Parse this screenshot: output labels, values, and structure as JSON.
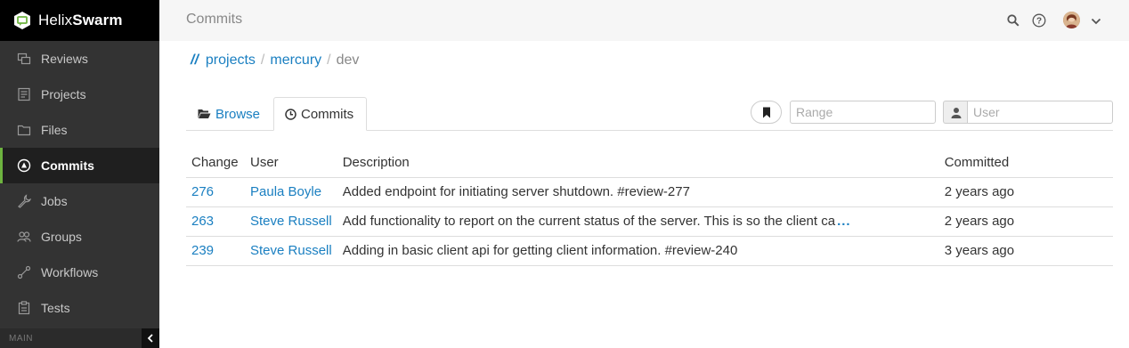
{
  "brand": {
    "name_light": "Helix",
    "name_bold": "Swarm"
  },
  "sidebar": {
    "items": [
      {
        "label": "Reviews",
        "icon": "reviews-icon"
      },
      {
        "label": "Projects",
        "icon": "projects-icon"
      },
      {
        "label": "Files",
        "icon": "folder-icon"
      },
      {
        "label": "Commits",
        "icon": "commit-icon",
        "active": true
      },
      {
        "label": "Jobs",
        "icon": "wrench-icon"
      },
      {
        "label": "Groups",
        "icon": "group-icon"
      },
      {
        "label": "Workflows",
        "icon": "workflow-icon"
      },
      {
        "label": "Tests",
        "icon": "clipboard-icon"
      }
    ],
    "footer_label": "MAIN"
  },
  "header": {
    "title": "Commits"
  },
  "breadcrumb": {
    "root": "//",
    "items": [
      "projects",
      "mercury"
    ],
    "current": "dev"
  },
  "tabs": {
    "browse": "Browse",
    "commits": "Commits"
  },
  "filters": {
    "range_placeholder": "Range",
    "user_placeholder": "User"
  },
  "table": {
    "headers": {
      "change": "Change",
      "user": "User",
      "description": "Description",
      "committed": "Committed"
    },
    "rows": [
      {
        "change": "276",
        "user": "Paula Boyle",
        "description": "Added endpoint for initiating server shutdown. #review-277",
        "truncated": false,
        "committed": "2 years ago"
      },
      {
        "change": "263",
        "user": "Steve Russell",
        "description": "Add functionality to report on the current status of the server. This is so the client ca",
        "truncated": true,
        "ellipsis": "...",
        "committed": "2 years ago"
      },
      {
        "change": "239",
        "user": "Steve Russell",
        "description": "Adding in basic client api for getting client information. #review-240",
        "truncated": false,
        "committed": "3 years ago"
      }
    ]
  },
  "colors": {
    "accent_green": "#6db33f",
    "link_blue": "#1a7fc1",
    "sidebar_bg": "#333333"
  }
}
